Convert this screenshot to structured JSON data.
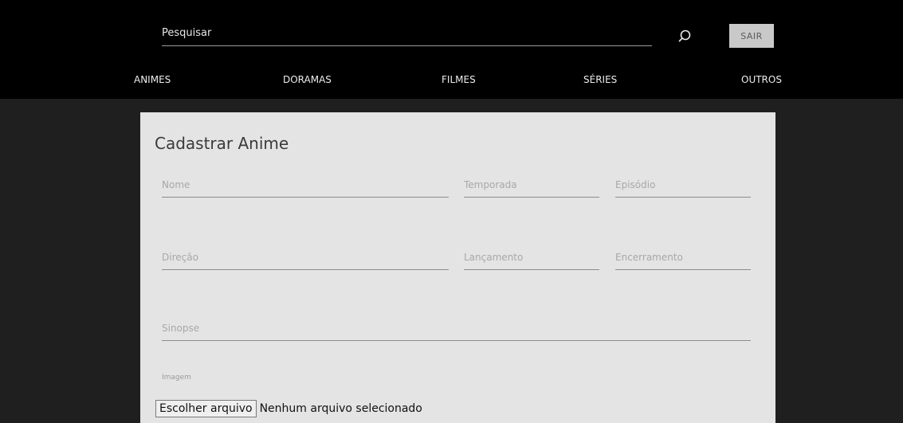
{
  "header": {
    "search_placeholder": "Pesquisar",
    "logout_label": "SAIR"
  },
  "nav": {
    "items": [
      {
        "label": "ANIMES"
      },
      {
        "label": "DORAMAS"
      },
      {
        "label": "FILMES"
      },
      {
        "label": "SÉRIES"
      },
      {
        "label": "OUTROS"
      }
    ]
  },
  "form": {
    "title": "Cadastrar Anime",
    "fields": {
      "nome": "Nome",
      "temporada": "Temporada",
      "episodio": "Episódio",
      "direcao": "Direção",
      "lancamento": "Lançamento",
      "encerramento": "Encerramento",
      "sinopse": "Sinopse"
    },
    "image_label": "Imagem",
    "file_button": "Escolher arquivo",
    "file_status": "Nenhum arquivo selecionado"
  },
  "colors": {
    "topbar": "#000000",
    "page_background": "#1f1f1f",
    "panel": "#e4e4e4",
    "logout_button": "#c9c9c9"
  }
}
